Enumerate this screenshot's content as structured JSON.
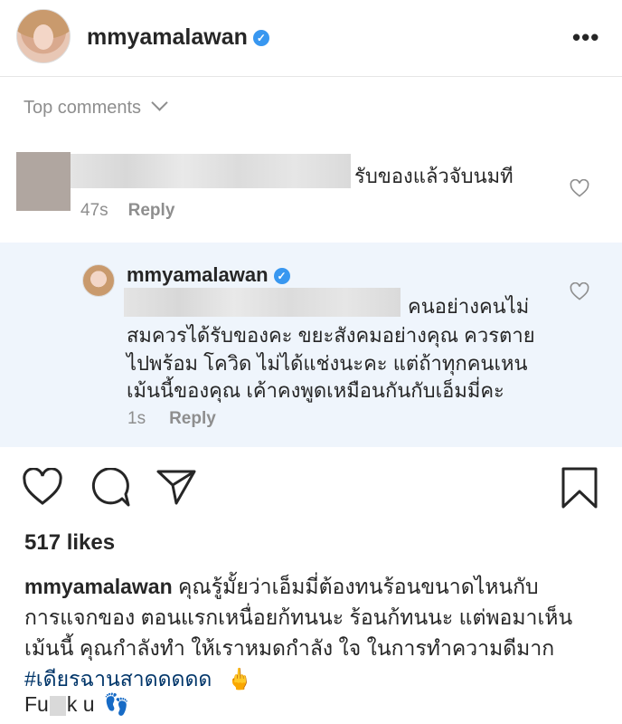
{
  "header": {
    "username": "mmyamalawan",
    "more_label": "•••"
  },
  "comments_filter": {
    "label": "Top comments"
  },
  "comment": {
    "text": "รับของแล้วจับนมที",
    "time": "47s",
    "reply_label": "Reply"
  },
  "reply": {
    "username": "mmyamalawan",
    "lines": [
      "คนอย่างคนไม่",
      "สมควรได้รับของคะ ขยะสังคมอย่างคุณ ควรตาย",
      "ไปพร้อม โควิด ไม่ได้แช่งนะคะ แต่ถ้าทุกคนเหน",
      "เม้นนี้ของคุณ เค้าคงพูดเหมือนกันกับเอ็มมี่คะ"
    ],
    "time": "1s",
    "reply_label": "Reply"
  },
  "post": {
    "likes": "517 likes",
    "caption_user": "mmyamalawan",
    "caption_lines": [
      "คุณรู้มั้ยว่าเอ็มมี่ต้องทนร้อนขนาดไหนกับ",
      "การแจกของ ตอนแรกเหนื่อยก้ทนนะ ร้อนก้ทนนะ แต่พอมาเห็น",
      "เม้นนี้ คุณกำลังทำ ให้เราหมดกำลัง ใจ ในการทำความดีมาก"
    ],
    "hashtag": "#เดียรฉานสาดดดดด",
    "hashtag_emoji": "🖕",
    "last_line_start": "Fu",
    "last_line_end": "k u",
    "last_line_emoji": "👣"
  },
  "colors": {
    "verified": "#3897f0",
    "reply_bg": "#eff5fc",
    "hashtag": "#003569",
    "muted": "#8e8e8e"
  }
}
